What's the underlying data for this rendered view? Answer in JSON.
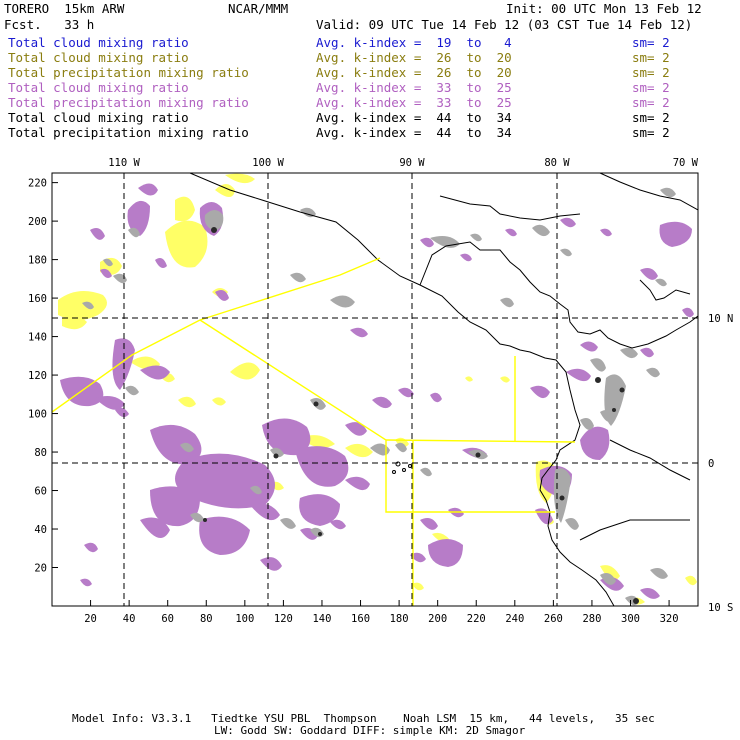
{
  "header": {
    "model": "TORERO  15km ARW",
    "org": "NCAR/MMM",
    "init": "Init: 00 UTC Mon 13 Feb 12",
    "fcst": "Fcst.   33 h",
    "valid": "Valid: 09 UTC Tue 14 Feb 12 (03 CST Tue 14 Feb 12)"
  },
  "legend": [
    {
      "field": "Total cloud mixing ratio",
      "kindex": "Avg. k-index =  19  to   4",
      "sm": "sm= 2",
      "color": "#1a1ad0"
    },
    {
      "field": "Total cloud mixing ratio",
      "kindex": "Avg. k-index =  26  to  20",
      "sm": "sm= 2",
      "color": "#8a7d10"
    },
    {
      "field": "Total precipitation mixing ratio",
      "kindex": "Avg. k-index =  26  to  20",
      "sm": "sm= 2",
      "color": "#8a7d10"
    },
    {
      "field": "Total cloud mixing ratio",
      "kindex": "Avg. k-index =  33  to  25",
      "sm": "sm= 2",
      "color": "#b060c0"
    },
    {
      "field": "Total precipitation mixing ratio",
      "kindex": "Avg. k-index =  33  to  25",
      "sm": "sm= 2",
      "color": "#b060c0"
    },
    {
      "field": "Total cloud mixing ratio",
      "kindex": "Avg. k-index =  44  to  34",
      "sm": "sm= 2",
      "color": "#000000"
    },
    {
      "field": "Total precipitation mixing ratio",
      "kindex": "Avg. k-index =  44  to  34",
      "sm": "sm= 2",
      "color": "#000000"
    }
  ],
  "axes": {
    "top_lon_labels": [
      "110 W",
      "100 W",
      "90 W",
      "80 W",
      "70 W"
    ],
    "right_lat_labels": [
      "10 N",
      "0",
      "10 S"
    ],
    "left_y_ticks": [
      "220",
      "200",
      "180",
      "160",
      "140",
      "120",
      "100",
      "80",
      "60",
      "40",
      "20"
    ],
    "bottom_x_ticks": [
      "20",
      "40",
      "60",
      "80",
      "100",
      "120",
      "140",
      "160",
      "180",
      "200",
      "220",
      "240",
      "260",
      "280",
      "300",
      "320"
    ]
  },
  "footer": {
    "line1": "Model Info: V3.3.1   Tiedtke YSU PBL  Thompson    Noah LSM  15 km,   44 levels,   35 sec",
    "line2": "LW: Godd SW: Goddard DIFF: simple KM: 2D Smagor"
  },
  "colors": {
    "purple": "#b77cc8",
    "gray": "#a9a9a9",
    "yellow": "#ffff66",
    "coast": "#000000",
    "domain_lines": "#ffff00"
  }
}
